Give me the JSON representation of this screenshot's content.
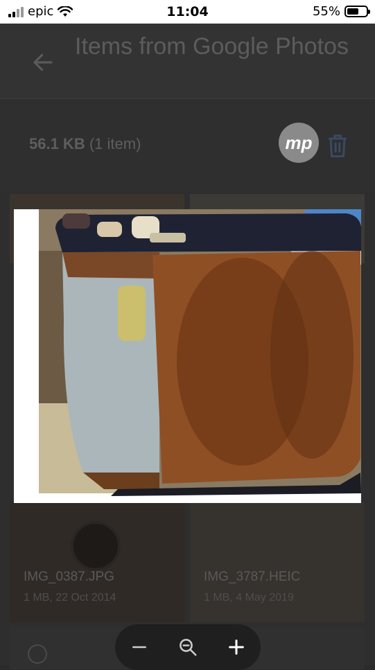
{
  "status_bar": {
    "carrier": "epic",
    "time": "11:04",
    "battery_percent": "55%",
    "battery_level": 0.55
  },
  "header": {
    "title": "Items from Google Photos",
    "back_icon": "arrow-left-icon"
  },
  "summary": {
    "size": "56.1 KB",
    "count": "(1 item)",
    "badge_text": "mp",
    "delete_icon": "trash-icon"
  },
  "files": [
    {
      "name": "IMG_0387.JPG",
      "meta": "1 MB, 22 Oct 2014"
    },
    {
      "name": "IMG_3787.HEIC",
      "meta": "1 MB, 4 May 2019"
    }
  ],
  "zoom_controls": {
    "zoom_out_icon": "minus-icon",
    "zoom_icon": "zoom-out-magnifier-icon",
    "zoom_in_icon": "plus-icon"
  },
  "colors": {
    "overlay": "#2e2e2e",
    "badge": "#8a8a8a",
    "trash": "#3b4a66"
  }
}
